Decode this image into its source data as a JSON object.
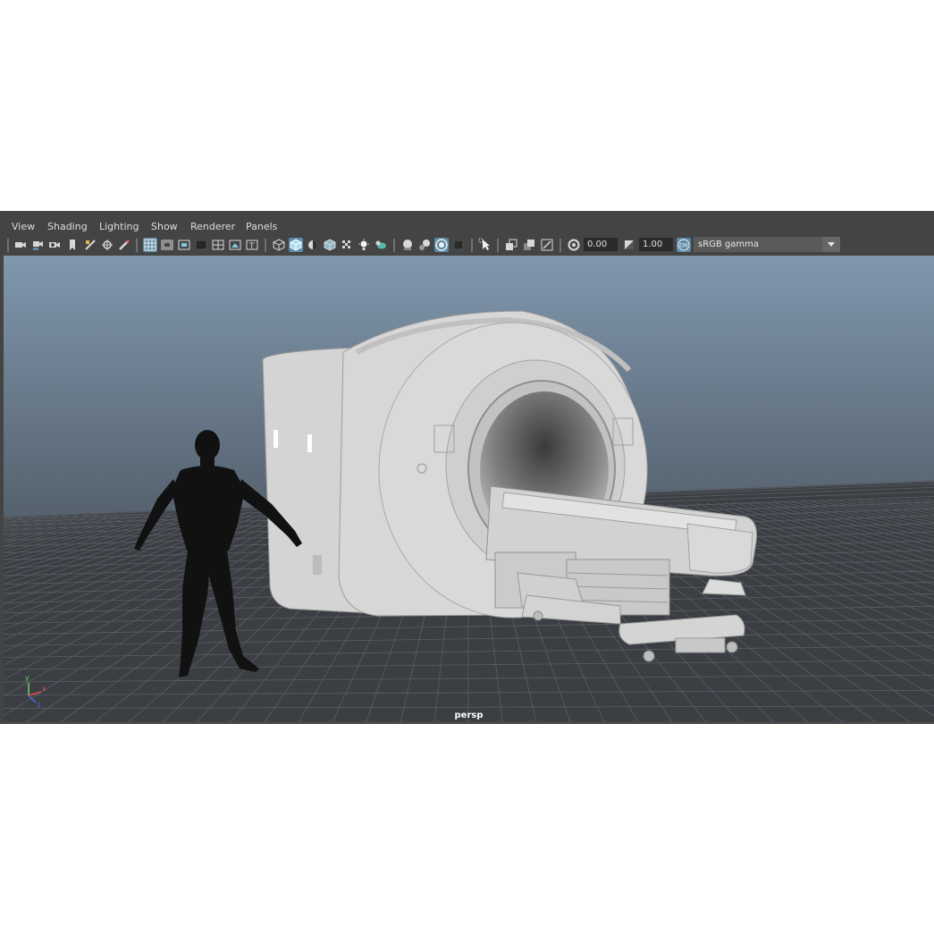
{
  "menubar": {
    "items": [
      "View",
      "Shading",
      "Lighting",
      "Show",
      "Renderer",
      "Panels"
    ]
  },
  "toolbar": {
    "exposure": "0.00",
    "gamma": "1.00",
    "color_space": "sRGB gamma"
  },
  "viewport": {
    "camera_label": "persp",
    "axis_y": "y",
    "axis_x": "x",
    "axis_z": "z"
  },
  "colors": {
    "panel_bg": "#444444",
    "highlight": "#5c8aa8",
    "viewport_top": "#7f96ac",
    "viewport_bottom": "#2a2c2f",
    "model": "#d7d7d7",
    "silhouette": "#111111"
  },
  "icons": [
    "select-camera-icon",
    "camera-attributes-icon",
    "bookmark-icon",
    "image-plane-icon",
    "grid-icon",
    "film-gate-icon",
    "resolution-gate-icon",
    "gate-mask-icon",
    "field-chart-icon",
    "safe-action-icon",
    "safe-title-icon",
    "wireframe-icon",
    "smooth-shade-icon",
    "shadows-icon",
    "textured-icon",
    "lighting-icon",
    "isolate-icon",
    "xray-icon",
    "xray-joints-icon",
    "ambient-occlusion-icon",
    "motion-blur-icon",
    "anti-alias-icon",
    "depth-of-field-icon",
    "exposure-icon",
    "gamma-icon",
    "color-management-icon"
  ]
}
